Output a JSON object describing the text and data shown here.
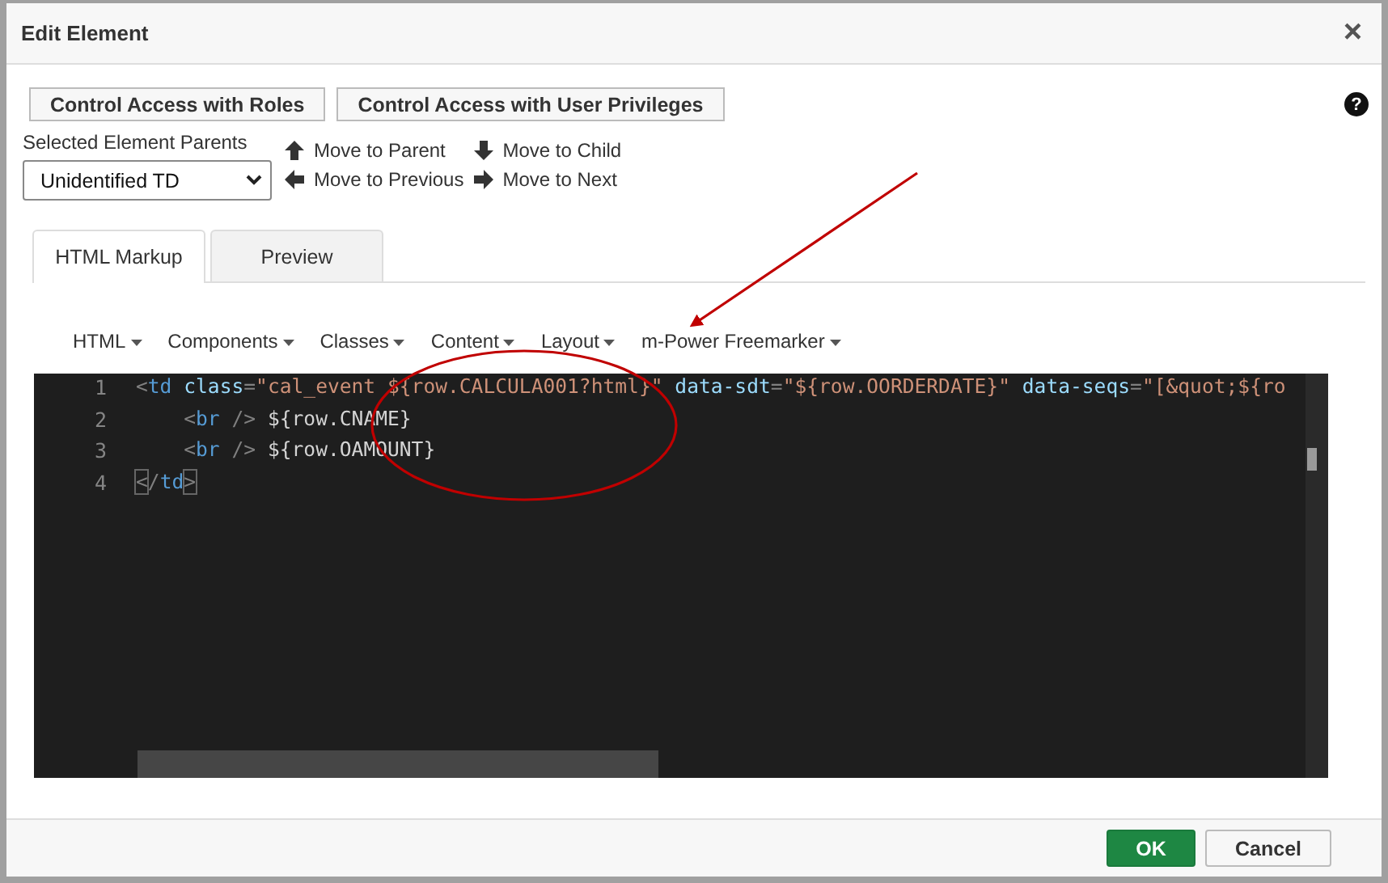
{
  "window": {
    "title": "Edit Element",
    "close": "×"
  },
  "access_buttons": [
    "Control Access with Roles",
    "Control Access with User Privileges"
  ],
  "help": "?",
  "parents": {
    "label": "Selected Element Parents",
    "value": "Unidentified TD"
  },
  "nav": [
    {
      "kind": "up",
      "label": "Move to Parent"
    },
    {
      "kind": "down",
      "label": "Move to Child"
    },
    {
      "kind": "left",
      "label": "Move to Previous"
    },
    {
      "kind": "right",
      "label": "Move to Next"
    }
  ],
  "tabs": [
    {
      "label": "HTML Markup",
      "selected": true
    },
    {
      "label": "Preview",
      "selected": false
    }
  ],
  "menus": [
    "HTML",
    "Components",
    "Classes",
    "Content",
    "Layout",
    "m-Power Freemarker"
  ],
  "code": [
    {
      "number": "1",
      "tokens": [
        {
          "kind": "punct",
          "text": "<"
        },
        {
          "kind": "tag",
          "text": "td"
        },
        {
          "kind": "attr",
          "text": " class"
        },
        {
          "kind": "punct",
          "text": "="
        },
        {
          "kind": "string",
          "text": "\"cal_event ${row.CALCULA001?html}\""
        },
        {
          "kind": "attr",
          "text": " data-sdt"
        },
        {
          "kind": "punct",
          "text": "="
        },
        {
          "kind": "string",
          "text": "\"${row.OORDERDATE}\""
        },
        {
          "kind": "attr",
          "text": " data-seqs"
        },
        {
          "kind": "punct",
          "text": "="
        },
        {
          "kind": "string",
          "text": "\"[&quot;${ro"
        }
      ]
    },
    {
      "number": "2",
      "tokens": [
        {
          "kind": "punct",
          "text": "    <"
        },
        {
          "kind": "tag",
          "text": "br"
        },
        {
          "kind": "punct",
          "text": " />"
        },
        {
          "kind": "text",
          "text": " ${row.CNAME}"
        }
      ]
    },
    {
      "number": "3",
      "tokens": [
        {
          "kind": "punct",
          "text": "    <"
        },
        {
          "kind": "tag",
          "text": "br"
        },
        {
          "kind": "punct",
          "text": " />"
        },
        {
          "kind": "text",
          "text": " ${row.OAMOUNT}"
        }
      ]
    },
    {
      "number": "4",
      "tokens": [
        {
          "kind": "match",
          "text": "<"
        },
        {
          "kind": "punct",
          "text": "/"
        },
        {
          "kind": "tag",
          "text": "td"
        },
        {
          "kind": "match",
          "text": ">"
        }
      ]
    }
  ],
  "footer_buttons": [
    {
      "kind": "primary",
      "label": "OK"
    },
    {
      "kind": "default",
      "label": "Cancel"
    }
  ]
}
